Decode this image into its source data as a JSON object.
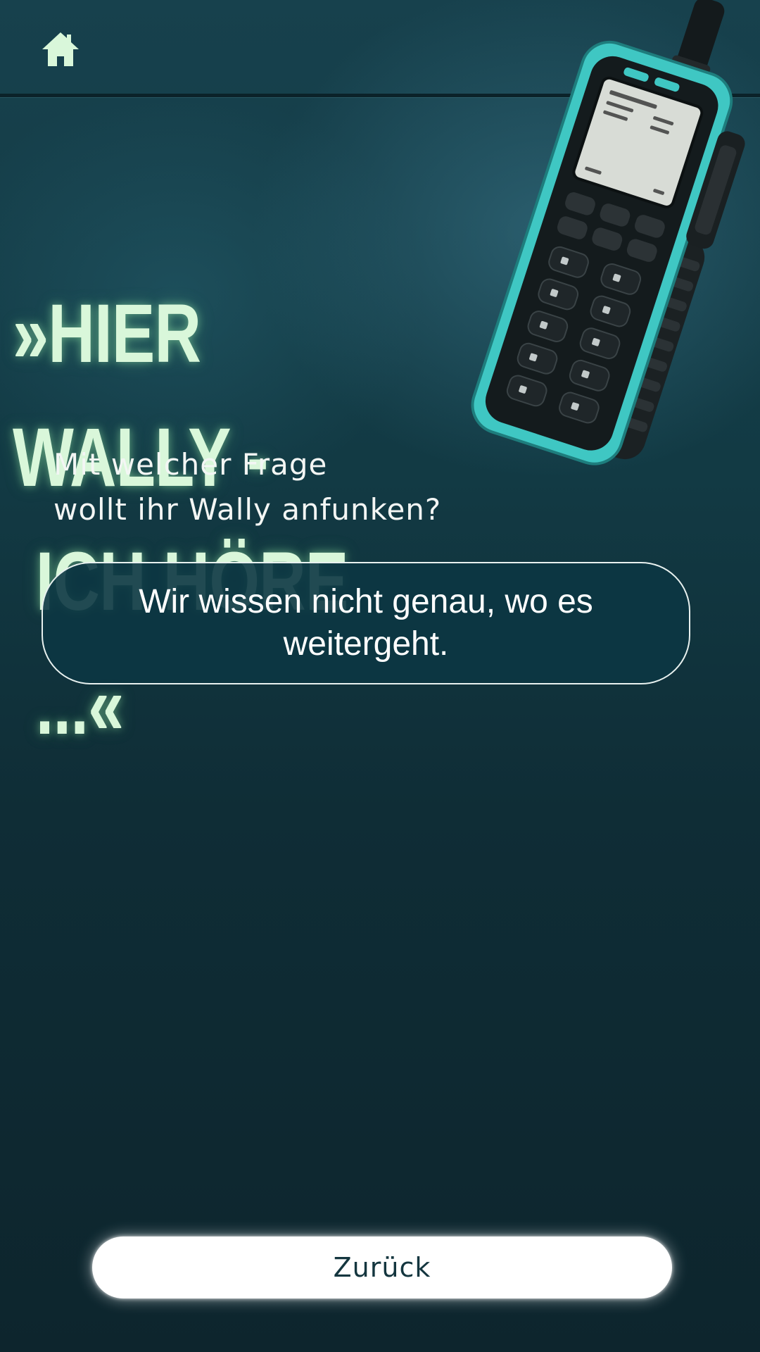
{
  "header": {
    "home_icon": "home-icon"
  },
  "hero": {
    "headline_line1": "»HIER WALLY -",
    "headline_line2": "ICH HÖRE ...«",
    "image": "walkie-talkie-illustration",
    "accent_color": "#d9f7da"
  },
  "question": {
    "line1": "Mit welcher Frage",
    "line2": "wollt ihr Wally anfunken?"
  },
  "answer": {
    "text": "Wir wissen nicht genau, wo es weitergeht."
  },
  "footer": {
    "back_label": "Zurück"
  },
  "colors": {
    "background_top": "#17414d",
    "background_bottom": "#0d252d",
    "phone_body": "#3fc7c3"
  }
}
